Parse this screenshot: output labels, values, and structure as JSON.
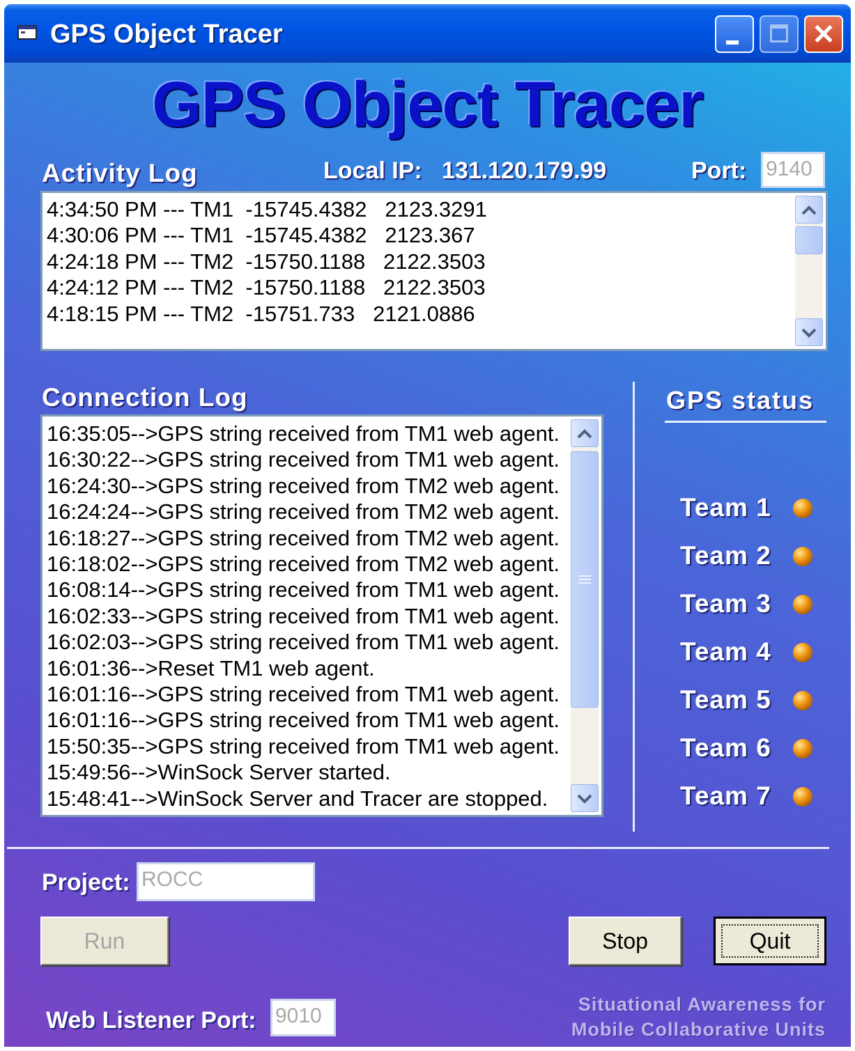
{
  "window": {
    "title": "GPS Object Tracer"
  },
  "banner": {
    "title": "GPS Object Tracer"
  },
  "activity": {
    "label": "Activity Log",
    "local_ip_label": "Local IP:",
    "local_ip": "131.120.179.99",
    "port_label": "Port:",
    "port": "9140",
    "entries": [
      "4:34:50 PM --- TM1  -15745.4382   2123.3291",
      "4:30:06 PM --- TM1  -15745.4382   2123.367",
      "4:24:18 PM --- TM2  -15750.1188   2122.3503",
      "4:24:12 PM --- TM2  -15750.1188   2122.3503",
      "4:18:15 PM --- TM2  -15751.733   2121.0886"
    ]
  },
  "connection": {
    "label": "Connection Log",
    "entries": [
      "16:35:05-->GPS string received from TM1 web agent.",
      "16:30:22-->GPS string received from TM1 web agent.",
      "16:24:30-->GPS string received from TM2 web agent.",
      "16:24:24-->GPS string received from TM2 web agent.",
      "16:18:27-->GPS string received from TM2 web agent.",
      "16:18:02-->GPS string received from TM2 web agent.",
      "16:08:14-->GPS string received from TM1 web agent.",
      "16:02:33-->GPS string received from TM1 web agent.",
      "16:02:03-->GPS string received from TM1 web agent.",
      "16:01:36-->Reset TM1 web agent.",
      "16:01:16-->GPS string received from TM1 web agent.",
      "16:01:16-->GPS string received from TM1 web agent.",
      "15:50:35-->GPS string received from TM1 web agent.",
      "15:49:56-->WinSock Server started.",
      "15:48:41-->WinSock Server and Tracer are stopped."
    ]
  },
  "gps_status": {
    "label": "GPS status",
    "indicator_color": "#f4a21c",
    "teams": [
      "Team 1",
      "Team 2",
      "Team 3",
      "Team 4",
      "Team 5",
      "Team 6",
      "Team 7"
    ]
  },
  "project": {
    "label": "Project:",
    "value": "ROCC"
  },
  "buttons": {
    "run": "Run",
    "stop": "Stop",
    "quit": "Quit"
  },
  "web_listener": {
    "label": "Web Listener Port:",
    "value": "9010"
  },
  "footer": {
    "line1": "Situational Awareness for",
    "line2": "Mobile Collaborative Units"
  }
}
